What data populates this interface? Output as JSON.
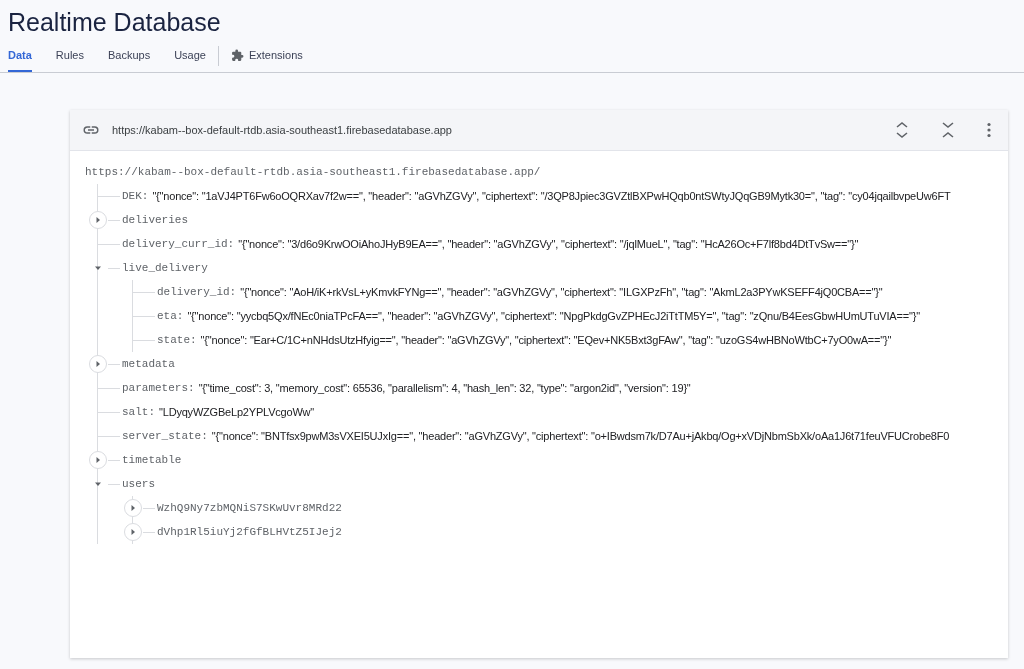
{
  "page_title": "Realtime Database",
  "tabs": [
    {
      "label": "Data",
      "selected": true,
      "kind": "text"
    },
    {
      "label": "Rules",
      "selected": false,
      "kind": "text"
    },
    {
      "label": "Backups",
      "selected": false,
      "kind": "text"
    },
    {
      "label": "Usage",
      "selected": false,
      "kind": "text"
    },
    {
      "label": "Extensions",
      "selected": false,
      "kind": "icon"
    }
  ],
  "card": {
    "url": "https://kabam--box-default-rtdb.asia-southeast1.firebasedatabase.app"
  },
  "tree": {
    "root": "https://kabam--box-default-rtdb.asia-southeast1.firebasedatabase.app/",
    "children": [
      {
        "key": "DEK:",
        "value": "\"{\"nonce\": \"1aVJ4PT6Fw6oOQRXav7f2w==\", \"header\": \"aGVhZGVy\", \"ciphertext\": \"/3QP8Jpiec3GVZtlBXPwHQqb0ntSWtyJQqGB9Mytk30=\", \"tag\": \"cy04jqailbvpeUw6FT"
      },
      {
        "key": "deliveries",
        "expanded": false
      },
      {
        "key": "delivery_curr_id:",
        "value": "\"{\"nonce\": \"3/d6o9KrwOOiAhoJHyB9EA==\", \"header\": \"aGVhZGVy\", \"ciphertext\": \"/jqlMueL\", \"tag\": \"HcA26Oc+F7lf8bd4DtTvSw==\"}\""
      },
      {
        "key": "live_delivery",
        "expanded": true,
        "children": [
          {
            "key": "delivery_id:",
            "value": "\"{\"nonce\": \"AoH/iK+rkVsL+yKmvkFYNg==\", \"header\": \"aGVhZGVy\", \"ciphertext\": \"ILGXPzFh\", \"tag\": \"AkmL2a3PYwKSEFF4jQ0CBA==\"}\""
          },
          {
            "key": "eta:",
            "value": "\"{\"nonce\": \"yycbq5Qx/fNEc0niaTPcFA==\", \"header\": \"aGVhZGVy\", \"ciphertext\": \"NpgPkdgGvZPHEcJ2iTtTM5Y=\", \"tag\": \"zQnu/B4EesGbwHUmUTuVIA==\"}\""
          },
          {
            "key": "state:",
            "value": "\"{\"nonce\": \"Ear+C/1C+nNHdsUtzHfyig==\", \"header\": \"aGVhZGVy\", \"ciphertext\": \"EQev+NK5Bxt3gFAw\", \"tag\": \"uzoGS4wHBNoWtbC+7yO0wA==\"}\""
          }
        ]
      },
      {
        "key": "metadata",
        "expanded": false
      },
      {
        "key": "parameters:",
        "value": "\"{\"time_cost\": 3, \"memory_cost\": 65536, \"parallelism\": 4, \"hash_len\": 32, \"type\": \"argon2id\", \"version\": 19}\""
      },
      {
        "key": "salt:",
        "value": "\"LDyqyWZGBeLp2YPLVcgoWw\""
      },
      {
        "key": "server_state:",
        "value": "\"{\"nonce\": \"BNTfsx9pwM3sVXEI5UJxIg==\", \"header\": \"aGVhZGVy\", \"ciphertext\": \"o+IBwdsm7k/D7Au+jAkbq/Og+xVDjNbmSbXk/oAa1J6t71feuVFUCrobe8F0"
      },
      {
        "key": "timetable",
        "expanded": false
      },
      {
        "key": "users",
        "expanded": true,
        "children": [
          {
            "key": "WzhQ9Ny7zbMQNiS7SKwUvr8MRd22",
            "expanded": false
          },
          {
            "key": "dVhp1Rl5iuYj2fGfBLHVtZ5IJej2",
            "expanded": false
          }
        ]
      }
    ]
  }
}
